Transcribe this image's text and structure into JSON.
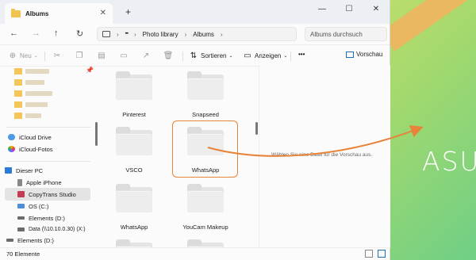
{
  "window": {
    "tab_title": "Albums",
    "new_tab": "+",
    "tab_close": "✕",
    "minimize": "—",
    "maximize": "☐",
    "close": "✕"
  },
  "address": {
    "back": "←",
    "forward": "→",
    "up": "↑",
    "refresh": "↻",
    "more": "•••",
    "crumbs": [
      "Photo library",
      "Albums"
    ],
    "search_placeholder": "Albums durchsuch"
  },
  "toolbar": {
    "new_label": "Neu",
    "sort_label": "Sortieren",
    "view_label": "Anzeigen",
    "more": "•••",
    "preview_label": "Vorschau"
  },
  "sidebar": {
    "items": [
      {
        "label": "iCloud Drive",
        "icon": "cloud-icon"
      },
      {
        "label": "iCloud-Fotos",
        "icon": "photos-icon"
      },
      {
        "label": "Dieser PC",
        "icon": "pc-icon"
      },
      {
        "label": "Apple iPhone",
        "icon": "phone-icon"
      },
      {
        "label": "CopyTrans Studio",
        "icon": "app-icon"
      },
      {
        "label": "OS (C:)",
        "icon": "drive-icon"
      },
      {
        "label": "Elements (D:)",
        "icon": "drive-icon"
      },
      {
        "label": "Data (\\\\10.10.0.30) (X:)",
        "icon": "network-drive-icon"
      },
      {
        "label": "Elements (D:)",
        "icon": "drive-icon"
      }
    ]
  },
  "folders": [
    {
      "name": "Pinterest"
    },
    {
      "name": "Snapseed"
    },
    {
      "name": "VSCO"
    },
    {
      "name": "WhatsApp"
    },
    {
      "name": "WhatsApp"
    },
    {
      "name": "YouCam Makeup"
    }
  ],
  "preview": {
    "message": "Wählen Sie eine Datei für die Vorschau aus."
  },
  "status": {
    "count": "70 Elemente"
  },
  "desktop": {
    "logo": "ASUS"
  },
  "colors": {
    "highlight": "#e8833a",
    "folder": "#e4e4e4"
  }
}
